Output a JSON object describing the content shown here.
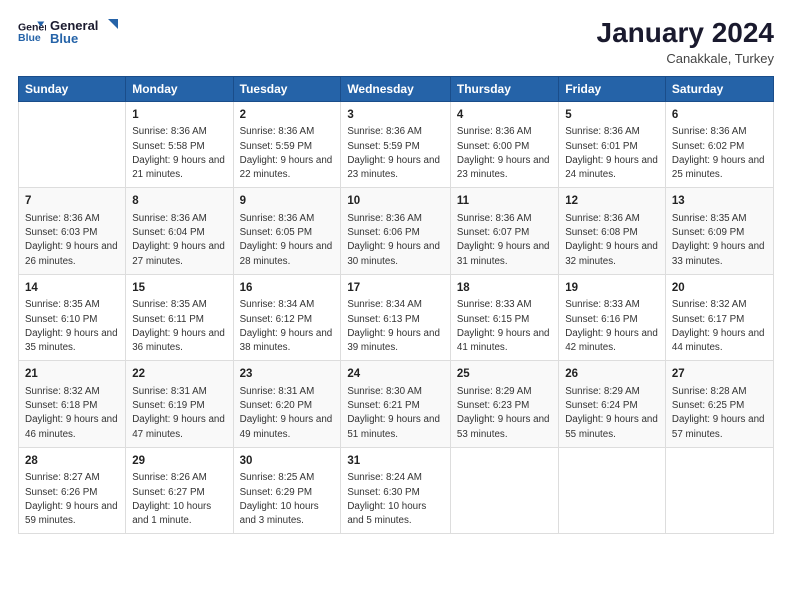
{
  "logo": {
    "line1": "General",
    "line2": "Blue"
  },
  "header": {
    "title": "January 2024",
    "subtitle": "Canakkale, Turkey"
  },
  "weekdays": [
    "Sunday",
    "Monday",
    "Tuesday",
    "Wednesday",
    "Thursday",
    "Friday",
    "Saturday"
  ],
  "weeks": [
    [
      {
        "day": "",
        "sunrise": "",
        "sunset": "",
        "daylight": ""
      },
      {
        "day": "1",
        "sunrise": "Sunrise: 8:36 AM",
        "sunset": "Sunset: 5:58 PM",
        "daylight": "Daylight: 9 hours and 21 minutes."
      },
      {
        "day": "2",
        "sunrise": "Sunrise: 8:36 AM",
        "sunset": "Sunset: 5:59 PM",
        "daylight": "Daylight: 9 hours and 22 minutes."
      },
      {
        "day": "3",
        "sunrise": "Sunrise: 8:36 AM",
        "sunset": "Sunset: 5:59 PM",
        "daylight": "Daylight: 9 hours and 23 minutes."
      },
      {
        "day": "4",
        "sunrise": "Sunrise: 8:36 AM",
        "sunset": "Sunset: 6:00 PM",
        "daylight": "Daylight: 9 hours and 23 minutes."
      },
      {
        "day": "5",
        "sunrise": "Sunrise: 8:36 AM",
        "sunset": "Sunset: 6:01 PM",
        "daylight": "Daylight: 9 hours and 24 minutes."
      },
      {
        "day": "6",
        "sunrise": "Sunrise: 8:36 AM",
        "sunset": "Sunset: 6:02 PM",
        "daylight": "Daylight: 9 hours and 25 minutes."
      }
    ],
    [
      {
        "day": "7",
        "sunrise": "Sunrise: 8:36 AM",
        "sunset": "Sunset: 6:03 PM",
        "daylight": "Daylight: 9 hours and 26 minutes."
      },
      {
        "day": "8",
        "sunrise": "Sunrise: 8:36 AM",
        "sunset": "Sunset: 6:04 PM",
        "daylight": "Daylight: 9 hours and 27 minutes."
      },
      {
        "day": "9",
        "sunrise": "Sunrise: 8:36 AM",
        "sunset": "Sunset: 6:05 PM",
        "daylight": "Daylight: 9 hours and 28 minutes."
      },
      {
        "day": "10",
        "sunrise": "Sunrise: 8:36 AM",
        "sunset": "Sunset: 6:06 PM",
        "daylight": "Daylight: 9 hours and 30 minutes."
      },
      {
        "day": "11",
        "sunrise": "Sunrise: 8:36 AM",
        "sunset": "Sunset: 6:07 PM",
        "daylight": "Daylight: 9 hours and 31 minutes."
      },
      {
        "day": "12",
        "sunrise": "Sunrise: 8:36 AM",
        "sunset": "Sunset: 6:08 PM",
        "daylight": "Daylight: 9 hours and 32 minutes."
      },
      {
        "day": "13",
        "sunrise": "Sunrise: 8:35 AM",
        "sunset": "Sunset: 6:09 PM",
        "daylight": "Daylight: 9 hours and 33 minutes."
      }
    ],
    [
      {
        "day": "14",
        "sunrise": "Sunrise: 8:35 AM",
        "sunset": "Sunset: 6:10 PM",
        "daylight": "Daylight: 9 hours and 35 minutes."
      },
      {
        "day": "15",
        "sunrise": "Sunrise: 8:35 AM",
        "sunset": "Sunset: 6:11 PM",
        "daylight": "Daylight: 9 hours and 36 minutes."
      },
      {
        "day": "16",
        "sunrise": "Sunrise: 8:34 AM",
        "sunset": "Sunset: 6:12 PM",
        "daylight": "Daylight: 9 hours and 38 minutes."
      },
      {
        "day": "17",
        "sunrise": "Sunrise: 8:34 AM",
        "sunset": "Sunset: 6:13 PM",
        "daylight": "Daylight: 9 hours and 39 minutes."
      },
      {
        "day": "18",
        "sunrise": "Sunrise: 8:33 AM",
        "sunset": "Sunset: 6:15 PM",
        "daylight": "Daylight: 9 hours and 41 minutes."
      },
      {
        "day": "19",
        "sunrise": "Sunrise: 8:33 AM",
        "sunset": "Sunset: 6:16 PM",
        "daylight": "Daylight: 9 hours and 42 minutes."
      },
      {
        "day": "20",
        "sunrise": "Sunrise: 8:32 AM",
        "sunset": "Sunset: 6:17 PM",
        "daylight": "Daylight: 9 hours and 44 minutes."
      }
    ],
    [
      {
        "day": "21",
        "sunrise": "Sunrise: 8:32 AM",
        "sunset": "Sunset: 6:18 PM",
        "daylight": "Daylight: 9 hours and 46 minutes."
      },
      {
        "day": "22",
        "sunrise": "Sunrise: 8:31 AM",
        "sunset": "Sunset: 6:19 PM",
        "daylight": "Daylight: 9 hours and 47 minutes."
      },
      {
        "day": "23",
        "sunrise": "Sunrise: 8:31 AM",
        "sunset": "Sunset: 6:20 PM",
        "daylight": "Daylight: 9 hours and 49 minutes."
      },
      {
        "day": "24",
        "sunrise": "Sunrise: 8:30 AM",
        "sunset": "Sunset: 6:21 PM",
        "daylight": "Daylight: 9 hours and 51 minutes."
      },
      {
        "day": "25",
        "sunrise": "Sunrise: 8:29 AM",
        "sunset": "Sunset: 6:23 PM",
        "daylight": "Daylight: 9 hours and 53 minutes."
      },
      {
        "day": "26",
        "sunrise": "Sunrise: 8:29 AM",
        "sunset": "Sunset: 6:24 PM",
        "daylight": "Daylight: 9 hours and 55 minutes."
      },
      {
        "day": "27",
        "sunrise": "Sunrise: 8:28 AM",
        "sunset": "Sunset: 6:25 PM",
        "daylight": "Daylight: 9 hours and 57 minutes."
      }
    ],
    [
      {
        "day": "28",
        "sunrise": "Sunrise: 8:27 AM",
        "sunset": "Sunset: 6:26 PM",
        "daylight": "Daylight: 9 hours and 59 minutes."
      },
      {
        "day": "29",
        "sunrise": "Sunrise: 8:26 AM",
        "sunset": "Sunset: 6:27 PM",
        "daylight": "Daylight: 10 hours and 1 minute."
      },
      {
        "day": "30",
        "sunrise": "Sunrise: 8:25 AM",
        "sunset": "Sunset: 6:29 PM",
        "daylight": "Daylight: 10 hours and 3 minutes."
      },
      {
        "day": "31",
        "sunrise": "Sunrise: 8:24 AM",
        "sunset": "Sunset: 6:30 PM",
        "daylight": "Daylight: 10 hours and 5 minutes."
      },
      {
        "day": "",
        "sunrise": "",
        "sunset": "",
        "daylight": ""
      },
      {
        "day": "",
        "sunrise": "",
        "sunset": "",
        "daylight": ""
      },
      {
        "day": "",
        "sunrise": "",
        "sunset": "",
        "daylight": ""
      }
    ]
  ]
}
